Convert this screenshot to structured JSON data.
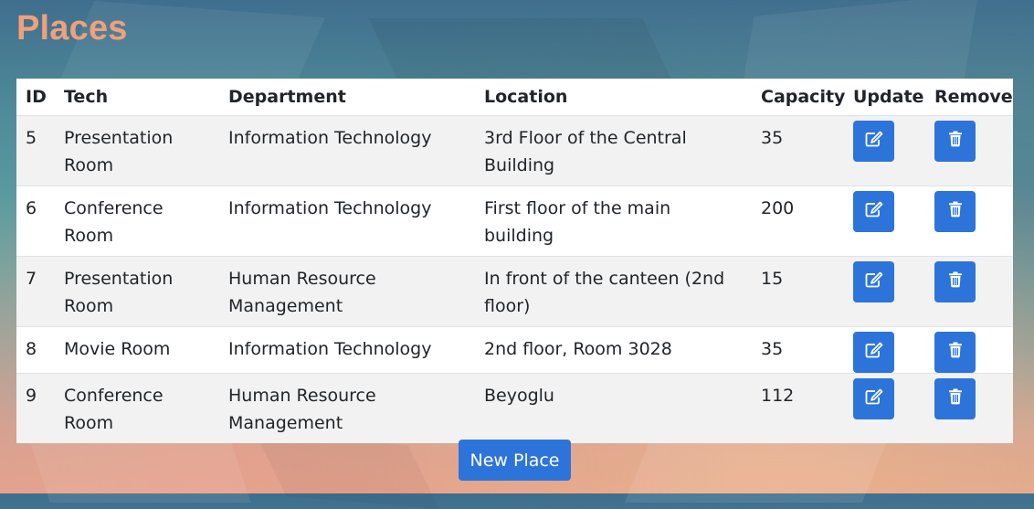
{
  "page": {
    "title": "Places"
  },
  "table": {
    "headers": {
      "id": "ID",
      "tech": "Tech",
      "department": "Department",
      "location": "Location",
      "capacity": "Capacity",
      "update": "Update",
      "remove": "Remove"
    },
    "rows": [
      {
        "id": "5",
        "tech": "Presentation Room",
        "department": "Information Technology",
        "location": "3rd Floor of the Central Building",
        "capacity": "35"
      },
      {
        "id": "6",
        "tech": "Conference Room",
        "department": "Information Technology",
        "location": "First floor of the main building",
        "capacity": "200"
      },
      {
        "id": "7",
        "tech": "Presentation Room",
        "department": "Human Resource Management",
        "location": "In front of the canteen (2nd floor)",
        "capacity": "15"
      },
      {
        "id": "8",
        "tech": "Movie Room",
        "department": "Information Technology",
        "location": "2nd floor, Room 3028",
        "capacity": "35"
      },
      {
        "id": "9",
        "tech": "Conference Room",
        "department": "Human Resource Management",
        "location": "Beyoglu",
        "capacity": "112"
      }
    ],
    "row_icons": {
      "update": "edit-icon",
      "remove": "trash-icon"
    }
  },
  "actions": {
    "new_place_label": "New Place"
  },
  "colors": {
    "title": "#f0a07a",
    "button": "#2d74da",
    "stripe": "#f2f2f2"
  }
}
